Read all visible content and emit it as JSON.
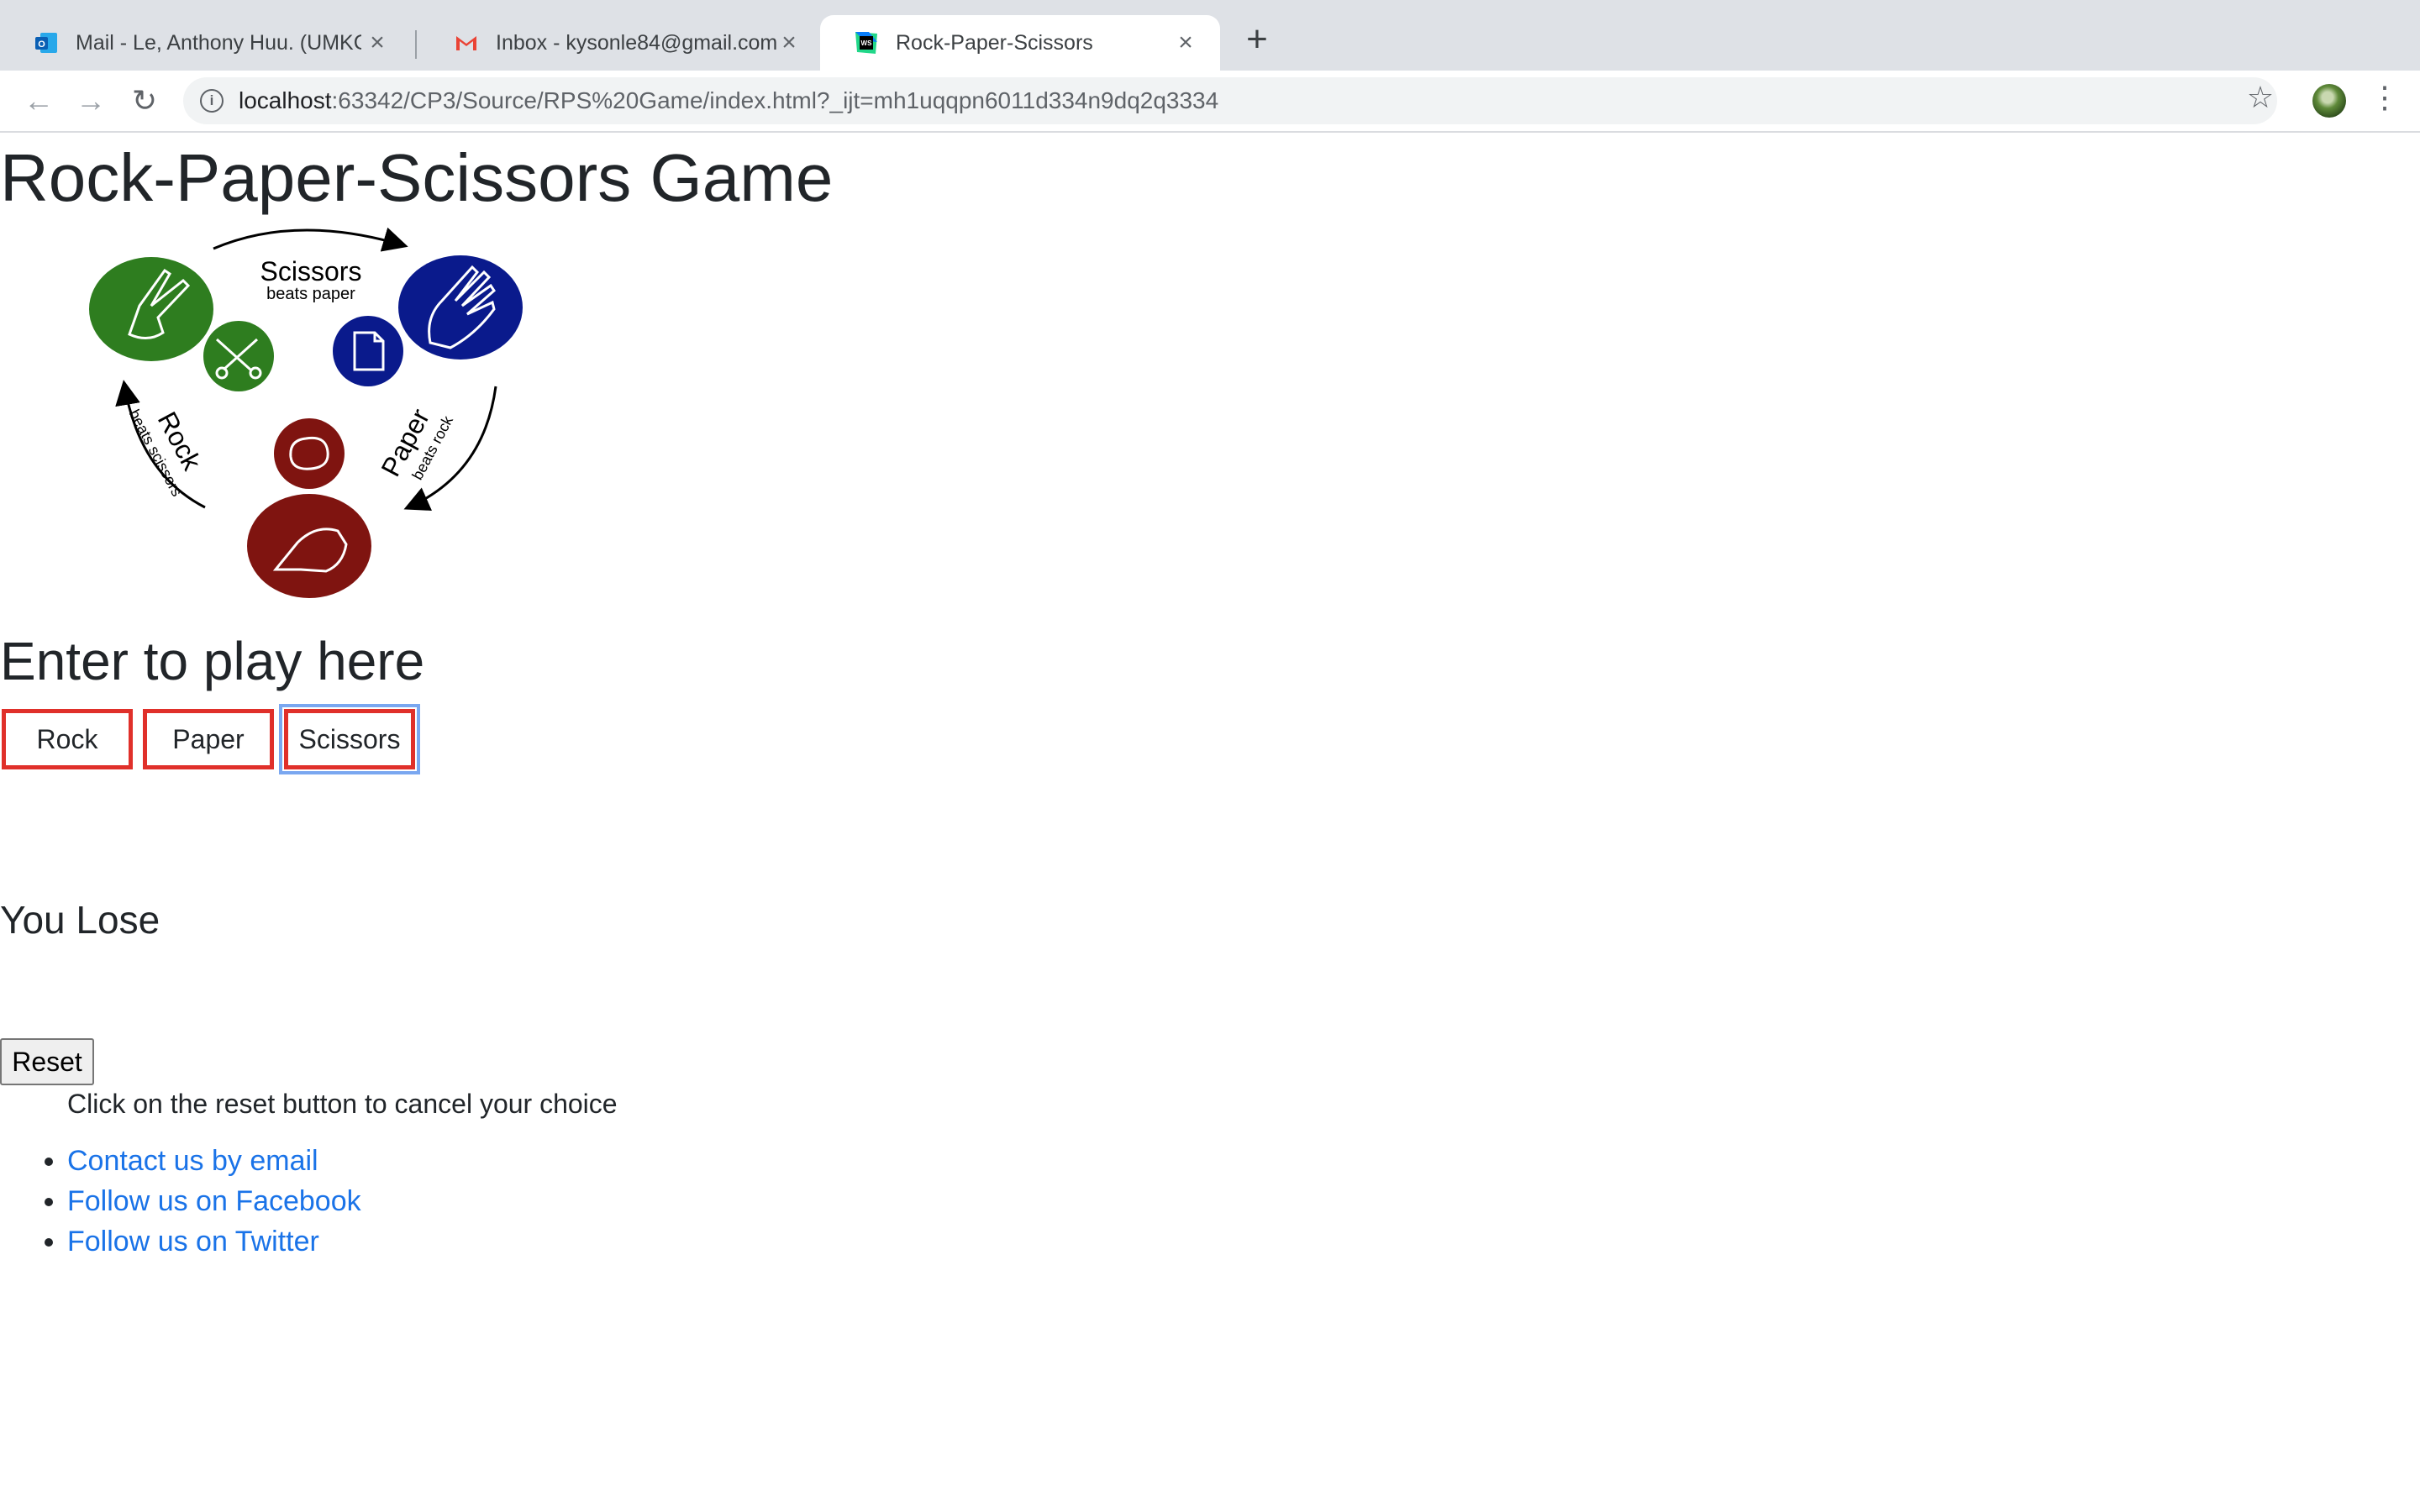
{
  "browser": {
    "tabs": [
      {
        "title": "Mail - Le, Anthony Huu. (UMKC",
        "icon": "outlook-icon"
      },
      {
        "title": "Inbox - kysonle84@gmail.com",
        "icon": "gmail-icon"
      },
      {
        "title": "Rock-Paper-Scissors",
        "icon": "webstorm-icon",
        "active": true
      }
    ],
    "url_host": "localhost",
    "url_rest": ":63342/CP3/Source/RPS%20Game/index.html?_ijt=mh1uqqpn6011d334n9dq2q3334"
  },
  "page": {
    "title": "Rock-Paper-Scissors Game",
    "diagram": {
      "scissors_label": "Scissors",
      "scissors_sub": "beats paper",
      "rock_label": "Rock",
      "rock_sub": "beats scissors",
      "paper_label": "Paper",
      "paper_sub": "beats rock"
    },
    "play_heading": "Enter to play here",
    "choices": {
      "rock": "Rock",
      "paper": "Paper",
      "scissors": "Scissors"
    },
    "result": "You Lose",
    "reset_label": "Reset",
    "reset_hint": "Click on the reset button to cancel your choice",
    "links": [
      "Contact us by email",
      "Follow us on Facebook",
      "Follow us on Twitter"
    ]
  },
  "colors": {
    "scissors_green": "#2e7d1f",
    "paper_blue": "#0a1a8c",
    "rock_red": "#7f1410",
    "choice_border": "#e0302a",
    "link_blue": "#1a73e8"
  }
}
